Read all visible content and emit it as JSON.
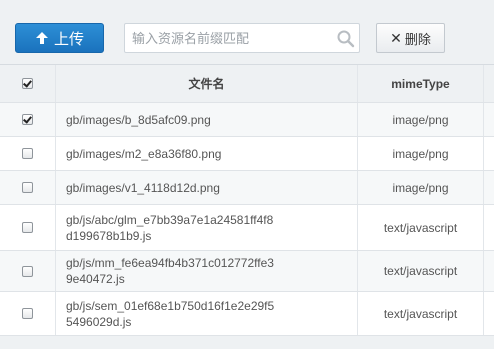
{
  "toolbar": {
    "upload_label": "上传",
    "search_placeholder": "输入资源名前缀匹配",
    "search_value": "",
    "delete_label": "删除",
    "accent": "#1f7bc6"
  },
  "table": {
    "header": {
      "name": "文件名",
      "mime": "mimeType",
      "select_all_checked": true
    },
    "rows": [
      {
        "name": "gb/images/b_8d5afc09.png",
        "mime": "image/png",
        "checked": true
      },
      {
        "name": "gb/images/m2_e8a36f80.png",
        "mime": "image/png",
        "checked": false
      },
      {
        "name": "gb/images/v1_4118d12d.png",
        "mime": "image/png",
        "checked": false
      },
      {
        "name": "gb/js/abc/glm_e7bb39a7e1a24581ff4f8\nd199678b1b9.js",
        "mime": "text/javascript",
        "checked": false
      },
      {
        "name": "gb/js/mm_fe6ea94fb4b371c012772ffe3\n9e40472.js",
        "mime": "text/javascript",
        "checked": false
      },
      {
        "name": "gb/js/sem_01ef68e1b750d16f1e2e29f5\n5496029d.js",
        "mime": "text/javascript",
        "checked": false
      }
    ]
  }
}
